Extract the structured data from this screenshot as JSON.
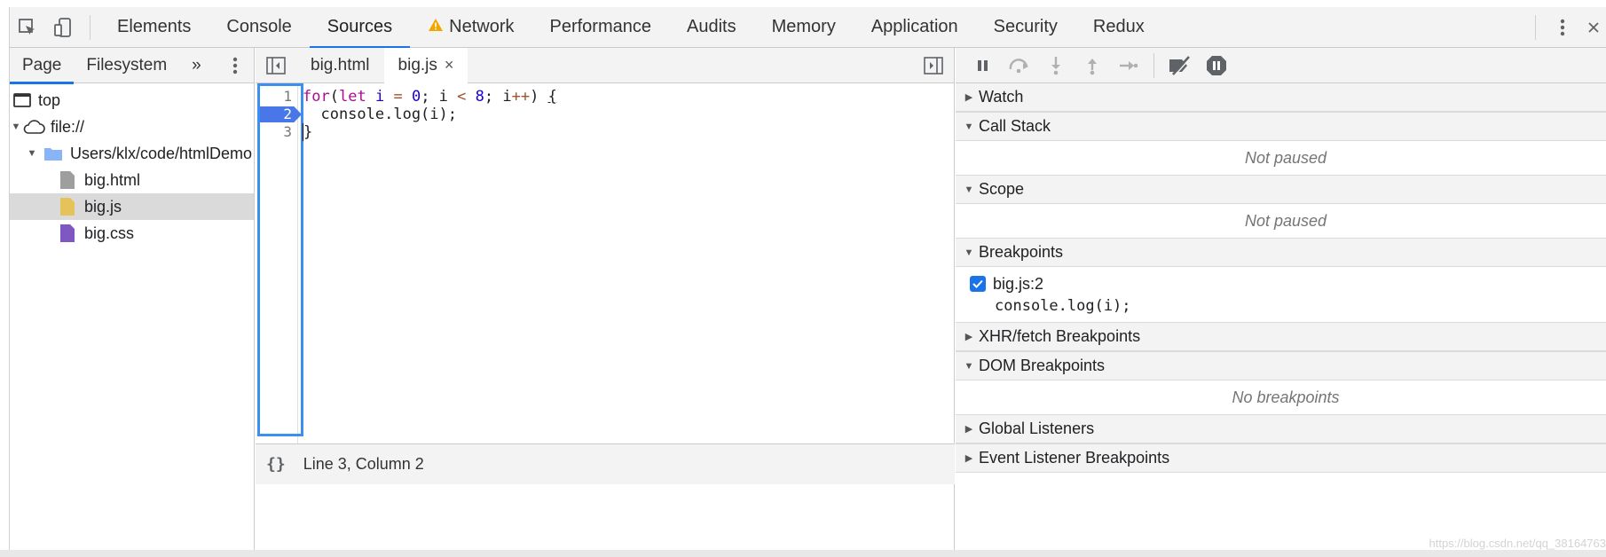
{
  "topbar": {
    "tabs": [
      "Elements",
      "Console",
      "Sources",
      "Network",
      "Performance",
      "Audits",
      "Memory",
      "Application",
      "Security",
      "Redux"
    ],
    "active_tab": "Sources",
    "warning_on": "Network"
  },
  "navigator": {
    "tabs": [
      "Page",
      "Filesystem"
    ],
    "more": "»",
    "tree": {
      "top": "top",
      "file": "file://",
      "folder": "Users/klx/code/htmlDemo",
      "files": [
        "big.html",
        "big.js",
        "big.css"
      ]
    },
    "selected_file": "big.js",
    "file_colors": [
      "#9e9e9e",
      "#e6c35a",
      "#7e57c2"
    ]
  },
  "editor": {
    "tabs": [
      "big.html",
      "big.js"
    ],
    "active_tab": "big.js",
    "close_glyph": "×",
    "line_numbers": [
      "1",
      "2",
      "3"
    ],
    "breakpoint_line": "2",
    "status_icon": "{}",
    "status": "Line 3, Column 2"
  },
  "debugger": {
    "sections": {
      "watch": "Watch",
      "call_stack": "Call Stack",
      "call_stack_empty": "Not paused",
      "scope": "Scope",
      "scope_empty": "Not paused",
      "breakpoints": "Breakpoints",
      "bp_location": "big.js:2",
      "bp_code": "console.log(i);",
      "xhr": "XHR/fetch Breakpoints",
      "dom": "DOM Breakpoints",
      "dom_empty": "No breakpoints",
      "global": "Global Listeners",
      "event": "Event Listener Breakpoints"
    }
  },
  "watermark": "https://blog.csdn.net/qq_38164763",
  "colors": {
    "accent": "#1a73e8",
    "breakpoint": "#4a77e8",
    "highlight_box": "#3d8fef"
  }
}
